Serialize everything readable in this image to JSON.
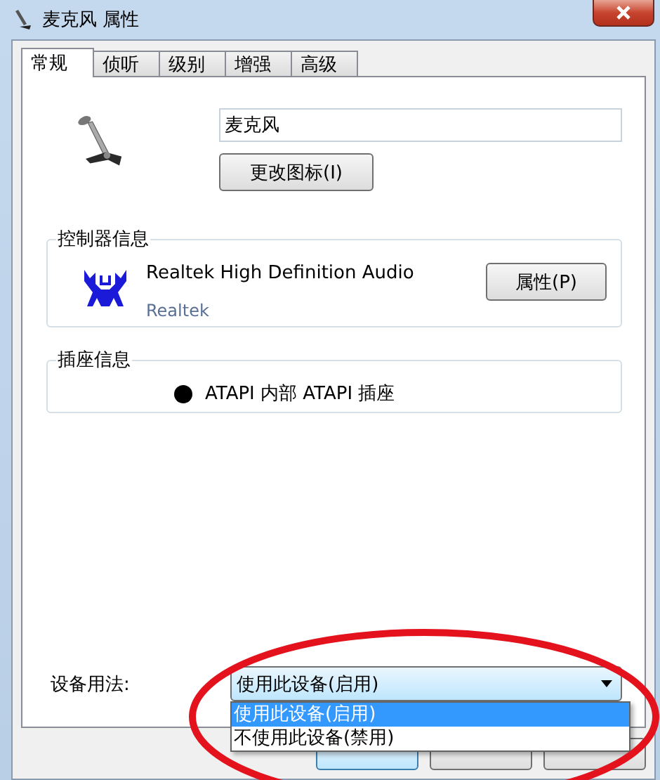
{
  "window": {
    "title": "麦克风 属性"
  },
  "tabs": [
    {
      "label": "常规",
      "selected": true
    },
    {
      "label": "侦听",
      "selected": false
    },
    {
      "label": "级别",
      "selected": false
    },
    {
      "label": "增强",
      "selected": false
    },
    {
      "label": "高级",
      "selected": false
    }
  ],
  "device": {
    "name": "麦克风",
    "change_icon_button": "更改图标(I)"
  },
  "controller": {
    "title": "控制器信息",
    "name": "Realtek High Definition Audio",
    "vendor": "Realtek",
    "properties_button": "属性(P)"
  },
  "jack": {
    "title": "插座信息",
    "description": "ATAPI 内部 ATAPI 插座"
  },
  "usage": {
    "label": "设备用法:",
    "value": "使用此设备(启用)",
    "expanded": true,
    "options": [
      {
        "label": "使用此设备(启用)",
        "selected": true
      },
      {
        "label": "不使用此设备(禁用)",
        "selected": false
      }
    ]
  },
  "footer_buttons": [
    {
      "kind": "default"
    },
    {
      "kind": "normal"
    },
    {
      "kind": "normal"
    }
  ],
  "annotation": {
    "kind": "ellipse"
  }
}
